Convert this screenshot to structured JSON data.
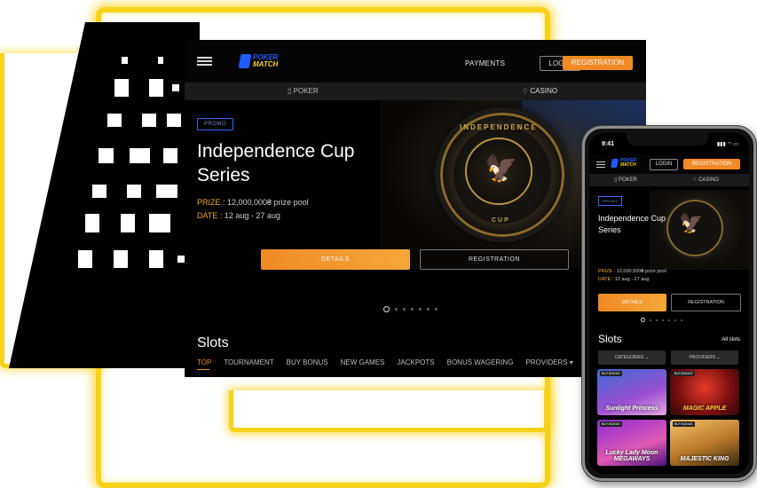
{
  "desktop": {
    "header": {
      "logo_line1": "POKER",
      "logo_line2": "MATCH",
      "payments": "PAYMENTS",
      "login": "LOGIN",
      "registration": "REGISTRATION"
    },
    "subnav": {
      "poker": "POKER",
      "casino": "CASINO"
    },
    "hero": {
      "badge": "PROMO",
      "title": "Independence Cup Series",
      "prize_label": "PRIZE",
      "prize_value": " : 12,000,000₴ prize pool",
      "date_label": "DATE",
      "date_value": " : 12 aug - 27 aug",
      "chip_top": "INDEPENDENCE",
      "chip_bottom": "CUP",
      "details_button": "DETAILS",
      "registration_button": "REGISTRATION",
      "slide_count": 7,
      "active_slide": 1
    },
    "slots": {
      "title": "Slots",
      "categories": [
        "TOP",
        "TOURNAMENT",
        "BUY BONUS",
        "NEW GAMES",
        "JACKPOTS",
        "BONUS WAGERING",
        "PROVIDERS ▾"
      ]
    }
  },
  "phone": {
    "status": {
      "time": "9:41"
    },
    "header": {
      "logo_line1": "POKER",
      "logo_line2": "MATCH",
      "login": "LOGIN",
      "registration": "REGISTRATION"
    },
    "subnav": {
      "poker": "POKER",
      "casino": "CASINO"
    },
    "hero": {
      "badge": "PROMO",
      "title": "Independence Cup Series",
      "prize_label": "PRIZE",
      "prize_value": " : 12,000,000₴ prize pool",
      "date_label": "DATE",
      "date_value": " : 12 aug - 27 aug",
      "details_button": "DETAILS",
      "registration_button": "REGISTRATION"
    },
    "slots": {
      "title": "Slots",
      "all_slots": "All slots",
      "categories_select": "CATEGORIES",
      "providers_select": "PROVIDERS",
      "games": [
        {
          "name": "Sunlight Princess",
          "badge": "BUY BONUS"
        },
        {
          "name": "MAGIC APPLE",
          "badge": "BUY BONUS"
        },
        {
          "name": "Lucky Lady Moon MEGAWAYS",
          "badge": "BUY BONUS"
        },
        {
          "name": "MAJESTIC KING",
          "badge": "BUY BONUS"
        }
      ]
    }
  },
  "colors": {
    "accent_orange": "#f08a24",
    "glow_yellow": "#f7d21a",
    "logo_blue": "#1e5bff",
    "background_dark": "#000000"
  },
  "icons": {
    "menu": "hamburger-icon",
    "poker": "poker-chip-icon",
    "casino": "diamond-icon",
    "providers_dropdown": "chevron-down-icon"
  }
}
